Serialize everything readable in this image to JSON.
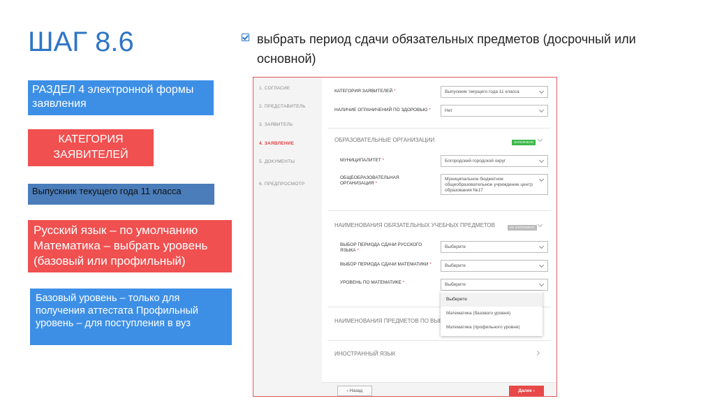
{
  "slide": {
    "title": "ШАГ 8.6",
    "bullet": "выбрать период сдачи обязательных предметов (досрочный или основной)",
    "boxes": {
      "section": "РАЗДЕЛ 4 электронной формы заявления",
      "category": "КАТЕГОРИЯ ЗАЯВИТЕЛЕЙ",
      "graduate": "Выпускник текущего года 11 класса",
      "subjects": "Русский язык – по умолчанию Математика – выбрать уровень (базовый или профильный)",
      "levels": "Базовый уровень – только для получения аттестата Профильный уровень – для поступления в вуз"
    }
  },
  "form": {
    "steps": [
      {
        "label": "1.    СОГЛАСИЕ"
      },
      {
        "label": "2.    ПРЕДСТАВИТЕЛЬ"
      },
      {
        "label": "3.    ЗАЯВИТЕЛЬ"
      },
      {
        "label": "4.    ЗАЯВЛЕНИЕ"
      },
      {
        "label": "5.    ДОКУМЕНТЫ"
      },
      {
        "label": "6.    ПРЕДПРОСМОТР"
      }
    ],
    "active_step": 4,
    "category_label": "КАТЕГОРИЯ ЗАЯВИТЕЛЕЙ",
    "category_value": "Выпускник текущего года 11 класса",
    "health_label": "НАЛИЧИЕ ОГРАНИЧЕНИЙ ПО ЗДОРОВЬЮ",
    "health_value": "Нет",
    "orgs_title": "ОБРАЗОВАТЕЛЬНЫЕ ОРГАНИЗАЦИИ",
    "orgs_badge": "ЗАПОЛНЕНО",
    "municipality_label": "МУНИЦИПАЛИТЕТ",
    "municipality_value": "Богородский городской округ",
    "school_label": "ОБЩЕОБРАЗОВАТЕЛЬНАЯ ОРГАНИЗАЦИЯ",
    "school_value": "Муниципальное бюджетное общеобразовательное учреждение центр образования №17",
    "subjects_title": "НАИМЕНОВАНИЯ ОБЯЗАТЕЛЬНЫХ УЧЕБНЫХ ПРЕДМЕТОВ",
    "subjects_badge": "НЕ ЗАПОЛНЕНО",
    "russian_label": "ВЫБОР ПЕРИОДА СДАЧИ РУССКОГО ЯЗЫКА",
    "russian_value": "Выберите",
    "math_label": "ВЫБОР ПЕРИОДА СДАЧИ МАТЕМАТИКИ",
    "math_value": "Выберите",
    "level_label": "УРОВЕНЬ ПО МАТЕМАТИКЕ",
    "level_value": "Выберите",
    "dropdown_options": [
      "Выберите",
      "Математика (базового уровня)",
      "Математика (профильного уровня)"
    ],
    "choice_title": "НАИМЕНОВАНИЯ ПРЕДМЕТОВ ПО ВЫБО",
    "foreign_title": "ИНОСТРАННЫЙ ЯЗЫК",
    "back_label": "‹  Назад",
    "next_label": "Далее  ›",
    "required_mark": "*"
  },
  "colors": {
    "title_blue": "#2e75c8",
    "box_blue": "#3d8fe6",
    "box_red": "#f05050",
    "badge_green": "#3cb94a",
    "badge_grey": "#bbbbbb",
    "form_border": "#e05858"
  },
  "icons": [
    "checkbox-icon",
    "chevron-down-icon",
    "chevron-right-icon"
  ]
}
